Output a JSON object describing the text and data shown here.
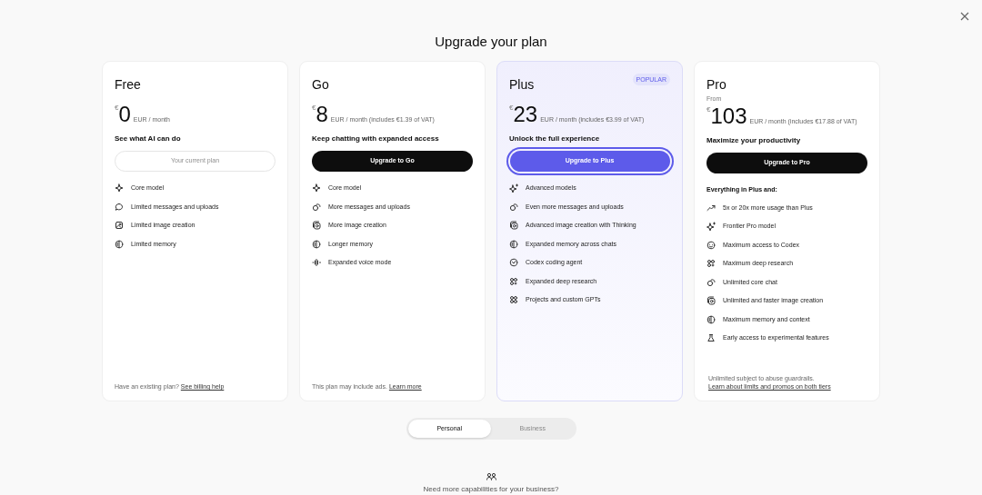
{
  "title": "Upgrade your plan",
  "plans": [
    {
      "name": "Free",
      "price": {
        "currency": "€",
        "amount": "0",
        "period": "EUR / month"
      },
      "tagline": "See what AI can do",
      "button": {
        "label": "Your current plan",
        "kind": "current"
      },
      "features": [
        "Core model",
        "Limited messages and uploads",
        "Limited image creation",
        "Limited memory"
      ],
      "note": {
        "kind": "inline",
        "text": "Have an existing plan?",
        "link": "See billing help"
      }
    },
    {
      "name": "Go",
      "price": {
        "currency": "€",
        "amount": "8",
        "period": "EUR / month (includes €1.39 of VAT)"
      },
      "tagline": "Keep chatting with expanded access",
      "button": {
        "label": "Upgrade to Go",
        "kind": "dark"
      },
      "features": [
        "Core model",
        "More messages and uploads",
        "More image creation",
        "Longer memory",
        "Expanded voice mode"
      ],
      "note": {
        "kind": "inline",
        "text": "This plan may include ads.",
        "link": "Learn more"
      }
    },
    {
      "name": "Plus",
      "badge": "POPULAR",
      "price": {
        "currency": "€",
        "amount": "23",
        "period": "EUR / month (includes €3.99 of VAT)"
      },
      "tagline": "Unlock the full experience",
      "button": {
        "label": "Upgrade to Plus",
        "kind": "accent"
      },
      "features": [
        "Advanced models",
        "Even more messages and uploads",
        "Advanced image creation with Thinking",
        "Expanded memory across chats",
        "Codex coding agent",
        "Expanded deep research",
        "Projects and custom GPTs"
      ]
    },
    {
      "name": "Pro",
      "from": "From",
      "price": {
        "currency": "€",
        "amount": "103",
        "period": "EUR / month (includes €17.88 of VAT)"
      },
      "tagline": "Maximize your productivity",
      "button": {
        "label": "Upgrade to Pro",
        "kind": "dark"
      },
      "features_heading": "Everything in Plus and:",
      "features": [
        "5x or 20x more usage than Plus",
        "Frontier Pro model",
        "Maximum access to Codex",
        "Maximum deep research",
        "Unlimited core chat",
        "Unlimited and faster image creation",
        "Maximum memory and context",
        "Early access to experimental features"
      ],
      "note": {
        "kind": "stacked",
        "text": "Unlimited subject to abuse guardrails.",
        "link": "Learn about limits and promos on both tiers"
      }
    }
  ],
  "segments": [
    {
      "label": "Personal",
      "selected": true
    },
    {
      "label": "Business",
      "selected": false
    }
  ],
  "business_prompt": "Need more capabilities for your business?"
}
